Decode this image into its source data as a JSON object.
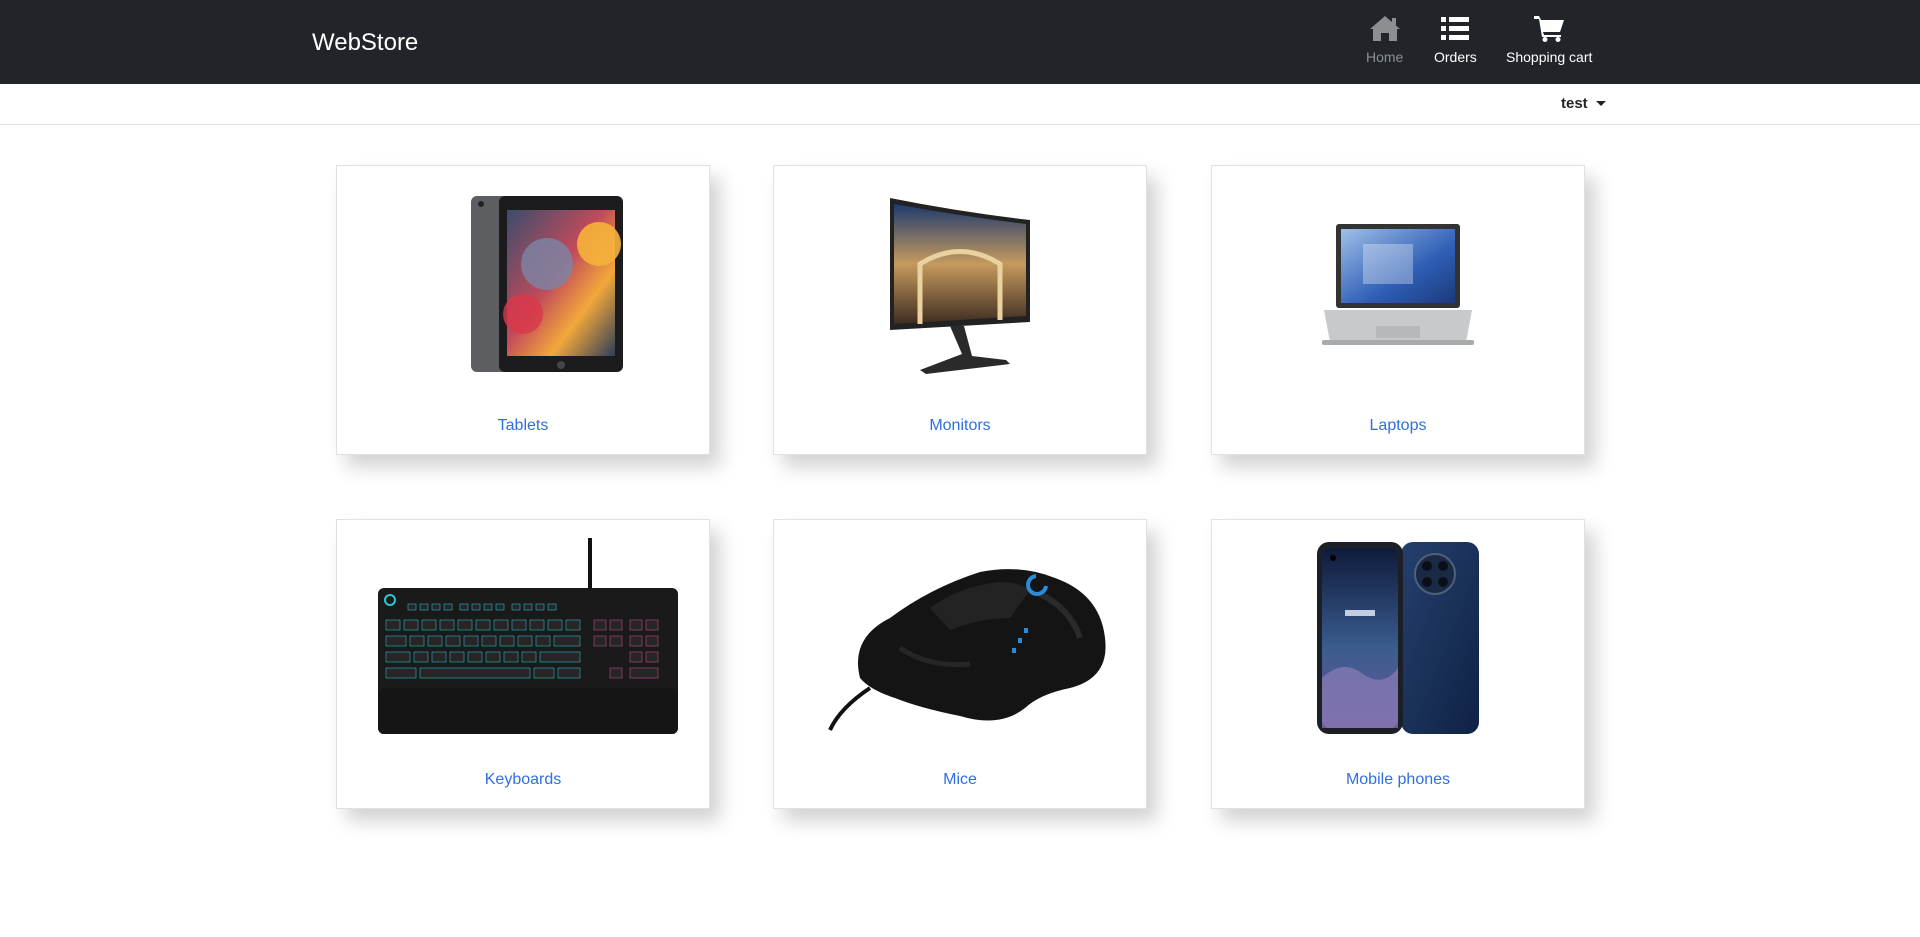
{
  "header": {
    "brand": "WebStore",
    "nav": {
      "home_label": "Home",
      "orders_label": "Orders",
      "cart_label": "Shopping cart"
    },
    "colors": {
      "background": "#212529",
      "active": "#ffffff",
      "muted": "#8c8f92"
    }
  },
  "user_menu": {
    "username": "test"
  },
  "categories": [
    {
      "label": "Tablets",
      "icon": "tablet-image"
    },
    {
      "label": "Monitors",
      "icon": "monitor-image"
    },
    {
      "label": "Laptops",
      "icon": "laptop-image"
    },
    {
      "label": "Keyboards",
      "icon": "keyboard-image"
    },
    {
      "label": "Mice",
      "icon": "mouse-image"
    },
    {
      "label": "Mobile phones",
      "icon": "phone-image"
    }
  ],
  "colors": {
    "link": "#2f6fe0"
  }
}
